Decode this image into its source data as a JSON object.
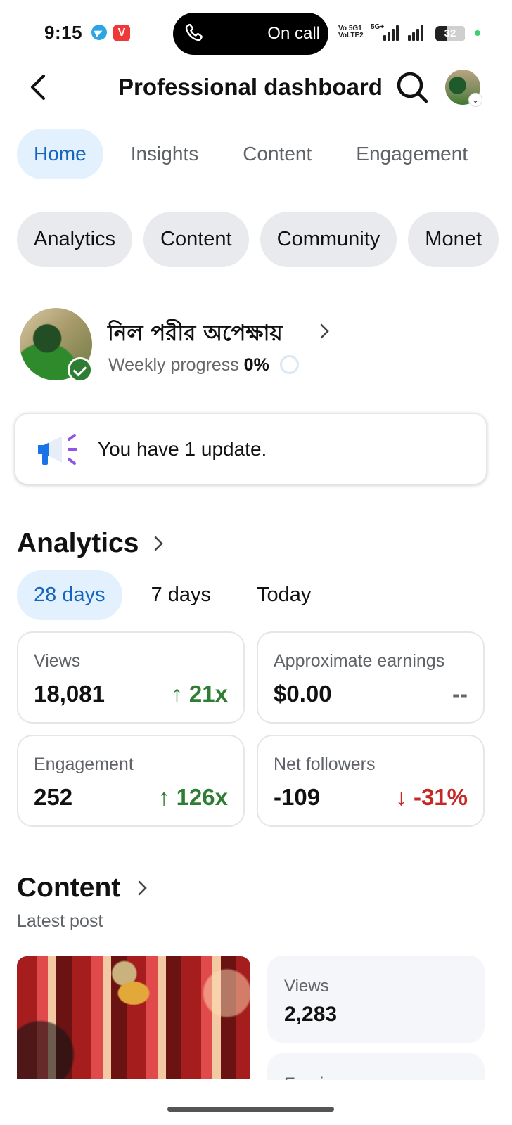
{
  "status_bar": {
    "time": "9:15",
    "call_label": "On call",
    "network_1": "Vo 5G\nVoLTE2",
    "network_2": "5G+",
    "battery": "32",
    "apps": [
      "telegram-icon",
      "vivaldi-icon"
    ]
  },
  "header": {
    "title": "Professional dashboard"
  },
  "tabs": [
    {
      "label": "Home",
      "active": true
    },
    {
      "label": "Insights"
    },
    {
      "label": "Content"
    },
    {
      "label": "Engagement"
    }
  ],
  "chips": [
    "Analytics",
    "Content",
    "Community",
    "Monet"
  ],
  "profile": {
    "name": "নিল পরীর অপেক্ষায়",
    "weekly_label": "Weekly progress",
    "weekly_value": "0%"
  },
  "update": {
    "text": "You have 1 update."
  },
  "analytics": {
    "title": "Analytics",
    "periods": [
      {
        "label": "28 days",
        "active": true
      },
      {
        "label": "7 days"
      },
      {
        "label": "Today"
      }
    ],
    "stats": [
      {
        "label": "Views",
        "value": "18,081",
        "change": "↑ 21x",
        "trend": "up"
      },
      {
        "label": "Approximate earnings",
        "value": "$0.00",
        "change": "--",
        "trend": "neutral"
      },
      {
        "label": "Engagement",
        "value": "252",
        "change": "↑ 126x",
        "trend": "up"
      },
      {
        "label": "Net followers",
        "value": "-109",
        "change": "↓ -31%",
        "trend": "down"
      }
    ]
  },
  "content": {
    "title": "Content",
    "subtitle": "Latest post",
    "post_views_label": "Views",
    "post_views_value": "2,283",
    "post_earnings_label": "Earnings"
  },
  "colors": {
    "accent": "#1565c0",
    "accent_bg": "#e3f0fd",
    "positive": "#2e7d32",
    "negative": "#c62828"
  }
}
